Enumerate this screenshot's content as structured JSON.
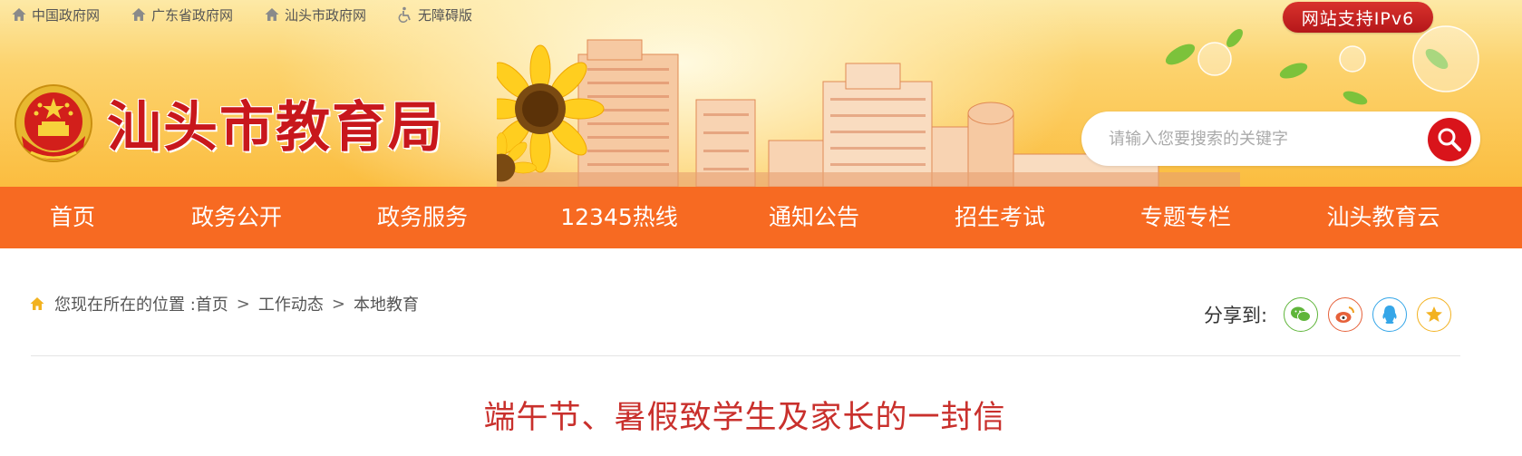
{
  "topbar": {
    "links": [
      {
        "label": "中国政府网",
        "icon": "home-icon"
      },
      {
        "label": "广东省政府网",
        "icon": "home-icon"
      },
      {
        "label": "汕头市政府网",
        "icon": "home-icon"
      },
      {
        "label": "无障碍版",
        "icon": "accessibility-icon"
      }
    ],
    "ipv6_badge": "网站支持IPv6"
  },
  "header": {
    "site_title": "汕头市教育局",
    "search_placeholder": "请输入您要搜索的关键字",
    "colors": {
      "title": "#c8171c",
      "search_button": "#d9141b"
    }
  },
  "nav": {
    "items": [
      {
        "label": "首页"
      },
      {
        "label": "政务公开"
      },
      {
        "label": "政务服务"
      },
      {
        "label": "12345热线"
      },
      {
        "label": "通知公告"
      },
      {
        "label": "招生考试"
      },
      {
        "label": "专题专栏"
      },
      {
        "label": "汕头教育云"
      }
    ],
    "color": "#f76a22"
  },
  "breadcrumb": {
    "prefix": "您现在所在的位置 : ",
    "items": [
      "首页",
      "工作动态",
      "本地教育"
    ],
    "separator": ">"
  },
  "share": {
    "label": "分享到:",
    "buttons": [
      {
        "icon": "wechat-icon",
        "color": "#5fb53a"
      },
      {
        "icon": "weibo-icon",
        "color": "#e6613a"
      },
      {
        "icon": "qq-icon",
        "color": "#35a6e8"
      },
      {
        "icon": "favorite-star-icon",
        "color": "#f3b221"
      }
    ]
  },
  "article": {
    "title": "端午节、暑假致学生及家长的一封信",
    "title_color": "#c9302c"
  }
}
